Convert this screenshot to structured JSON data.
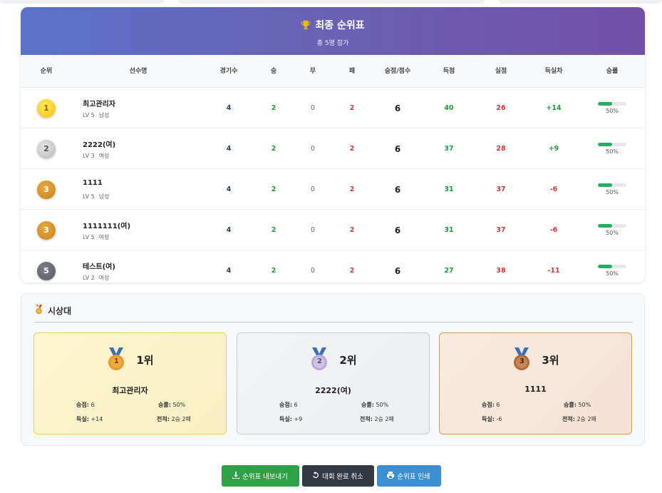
{
  "standings": {
    "title": "최종 순위표",
    "subtitle": "총 5명 참가",
    "columns": {
      "rank": "순위",
      "name": "선수명",
      "games": "경기수",
      "wins": "승",
      "draws": "무",
      "losses": "패",
      "points": "승점/점수",
      "goals_for": "득점",
      "goals_against": "실점",
      "goal_diff": "득실차",
      "win_rate": "승률"
    },
    "rows": [
      {
        "rank": "1",
        "name": "최고관리자",
        "level": "LV 5",
        "gender": "남성",
        "games": "4",
        "wins": "2",
        "draws": "0",
        "losses": "2",
        "points": "6",
        "gf": "40",
        "ga": "26",
        "gd": "+14",
        "win_rate": "50%",
        "win_rate_value": 0.5
      },
      {
        "rank": "2",
        "name": "2222(여)",
        "level": "LV 3",
        "gender": "여성",
        "games": "4",
        "wins": "2",
        "draws": "0",
        "losses": "2",
        "points": "6",
        "gf": "37",
        "ga": "28",
        "gd": "+9",
        "win_rate": "50%",
        "win_rate_value": 0.5
      },
      {
        "rank": "3",
        "name": "1111",
        "level": "LV 5",
        "gender": "남성",
        "games": "4",
        "wins": "2",
        "draws": "0",
        "losses": "2",
        "points": "6",
        "gf": "31",
        "ga": "37",
        "gd": "-6",
        "win_rate": "50%",
        "win_rate_value": 0.5
      },
      {
        "rank": "3",
        "name": "1111111(여)",
        "level": "LV 5",
        "gender": "여성",
        "games": "4",
        "wins": "2",
        "draws": "0",
        "losses": "2",
        "points": "6",
        "gf": "31",
        "ga": "37",
        "gd": "-6",
        "win_rate": "50%",
        "win_rate_value": 0.5
      },
      {
        "rank": "5",
        "name": "테스트(여)",
        "level": "LV 2",
        "gender": "여성",
        "games": "4",
        "wins": "2",
        "draws": "0",
        "losses": "2",
        "points": "6",
        "gf": "27",
        "ga": "38",
        "gd": "-11",
        "win_rate": "50%",
        "win_rate_value": 0.5
      }
    ]
  },
  "podium": {
    "title": "시상대",
    "cards": [
      {
        "place": "1위",
        "medal_num": "1",
        "name": "최고관리자",
        "points_label": "승점:",
        "points": "6",
        "winrate_label": "승률:",
        "winrate": "50%",
        "gd_label": "득실:",
        "gd": "+14",
        "record_label": "전적:",
        "record": "2승 2패"
      },
      {
        "place": "2위",
        "medal_num": "2",
        "name": "2222(여)",
        "points_label": "승점:",
        "points": "6",
        "winrate_label": "승률:",
        "winrate": "50%",
        "gd_label": "득실:",
        "gd": "+9",
        "record_label": "전적:",
        "record": "2승 2패"
      },
      {
        "place": "3위",
        "medal_num": "3",
        "name": "1111",
        "points_label": "승점:",
        "points": "6",
        "winrate_label": "승률:",
        "winrate": "50%",
        "gd_label": "득실:",
        "gd": "-6",
        "record_label": "전적:",
        "record": "2승 2패"
      }
    ]
  },
  "buttons": {
    "export": "순위표 내보내기",
    "cancel": "대회 완료 취소",
    "print": "순위표 인쇄"
  },
  "icons": {
    "title": "trophy-icon",
    "podium": "medal-icon",
    "export": "download-icon",
    "cancel": "undo-icon",
    "print": "printer-icon"
  },
  "colors": {
    "header_start": "#5b73c8",
    "header_end": "#7250a8",
    "win": "#1e9a3c",
    "loss": "#d6363b",
    "btn_export": "#2ea046",
    "btn_cancel": "#343a44",
    "btn_print": "#3c8fd0"
  }
}
